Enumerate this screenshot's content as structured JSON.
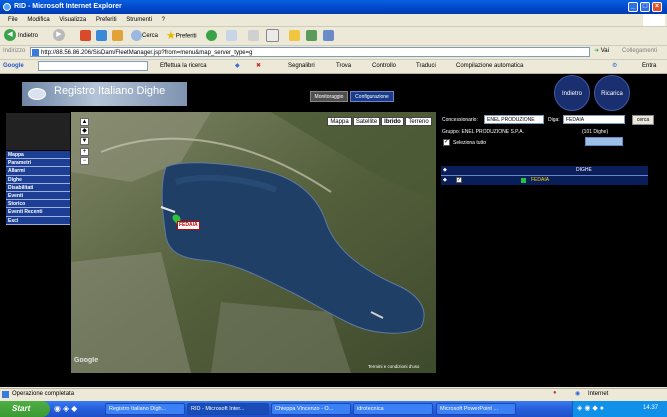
{
  "window": {
    "title": "RID - Microsoft Internet Explorer"
  },
  "menu": [
    "File",
    "Modifica",
    "Visualizza",
    "Preferiti",
    "Strumenti",
    "?"
  ],
  "toolbar": {
    "back": "Indietro",
    "search": "Cerca",
    "favorites": "Preferiti"
  },
  "address": {
    "label": "Indirizzo",
    "url": "http://88.56.86.206/SisDam/FleetManager.jsp?from=menu&map_server_type=g",
    "go": "Vai",
    "links": "Collegamenti"
  },
  "googlebar": {
    "brand": "Google",
    "search_button": "Effettua la ricerca",
    "bookmarks": "Segnalibri",
    "find": "Trova",
    "check": "Controllo",
    "translate": "Traduci",
    "autofill": "Compilazione automatica",
    "settings": "Entra"
  },
  "site": {
    "logo": "Registro Italiano Dighe",
    "tabs": [
      "Monitoraggio",
      "Configurazione"
    ],
    "buttons": [
      "Indietro",
      "Ricarica"
    ]
  },
  "sidebar": {
    "items": [
      "Mappa",
      "Parametri",
      "Allarmi",
      "Dighe",
      "Disabilitati",
      "Eventi",
      "Storico",
      "Eventi Recenti",
      "Esci"
    ]
  },
  "map": {
    "types": [
      "Mappa",
      "Satellite",
      "Ibrido",
      "Terreno"
    ],
    "marker_label": "FEDAIA",
    "copyright": "Termini e condizioni d'uso",
    "watermark": "Google"
  },
  "panel": {
    "concessionario_label": "Concessionario:",
    "concessionario_value": "ENEL PRODUZIONE",
    "diga_label": "Diga:",
    "diga_value": "FEDAIA",
    "cerca": "cerca",
    "gruppo": "Gruppo: ENEL PRODUZIONE S.P.A.",
    "count": "(101 Dighe)",
    "select_all": "Seleziona tutto",
    "table_header": "DIGHE",
    "rows": [
      {
        "name": "FEDAIA"
      }
    ]
  },
  "status": {
    "text": "Operazione completata",
    "zone": "Internet"
  },
  "taskbar": {
    "start": "Start",
    "tasks": [
      "Registro Italiano Digh...",
      "RID - Microsoft Inter...",
      "Chieppa Vincenzo - O...",
      "idrotecnica",
      "Microsoft PowerPoint ..."
    ],
    "clock": "14.37"
  }
}
